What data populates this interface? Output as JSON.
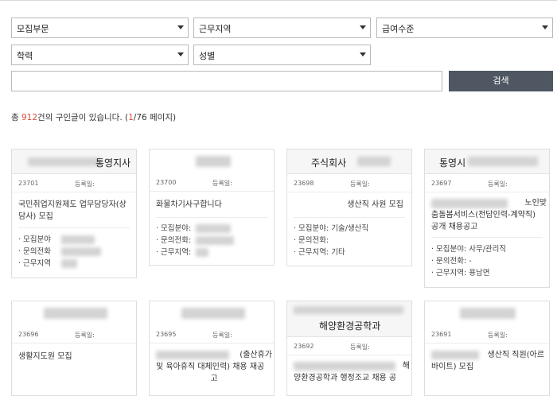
{
  "filters": {
    "job_category": "모집부문",
    "work_area": "근무지역",
    "salary": "급여수준",
    "education": "학력",
    "gender": "성별"
  },
  "search": {
    "button_label": "검색",
    "query": ""
  },
  "summary": {
    "prefix": "총 ",
    "count": "912",
    "middle": "건의 구인글이 있습니다. (",
    "page": "1",
    "suffix": "/76 페이지)"
  },
  "cards": [
    {
      "company": "통영지사",
      "number": "23701",
      "reg_label": "등록일:",
      "title_l1": "국민취업지원제도 업무담당자(상",
      "title_l2": "담사) 모집",
      "item1": "· 모집분야",
      "item2": "· 문의전화",
      "item3": "· 근무지역"
    },
    {
      "company": "",
      "number": "23700",
      "reg_label": "등록일:",
      "title_l1": "화물차기사구합니다",
      "item1": "· 모집분야:",
      "item2": "· 문의전화:",
      "item3": "· 근무지역:"
    },
    {
      "company": "주식회사",
      "number": "23698",
      "reg_label": "등록일:",
      "title_l1": "생산직 사원 모집",
      "item1": "· 모집분야: 기술/생산직",
      "item2": "· 문의전화:",
      "item3": "· 근무지역: 기타"
    },
    {
      "company": "통영시",
      "number": "23697",
      "reg_label": "등록일:",
      "title_l1": "노인맞",
      "title_l2": "춤돌봄서비스(전담인력-계약직)",
      "title_l3": "공개 채용공고",
      "item1": "· 모집분야: 사무/관리직",
      "item2": "· 문의전화: -",
      "item3": "· 근무지역: 용남면"
    },
    {
      "company": "",
      "number": "23696",
      "reg_label": "등록일:",
      "title_l1": "생활지도원 모집"
    },
    {
      "company": "",
      "number": "23695",
      "reg_label": "등록일:",
      "title_l1": "(출산휴가",
      "title_l2": "및 육아휴직 대체인력) 채용 재공",
      "title_l3": "고"
    },
    {
      "company": "해양환경공학과",
      "number": "23692",
      "reg_label": "등록일:",
      "title_l1": "해",
      "title_l2": "양환경공학과 행정조교 채용 공"
    },
    {
      "company": "",
      "number": "23691",
      "reg_label": "등록일:",
      "title_l1": "생산직 직원(아르",
      "title_l2": "바이트) 모집"
    }
  ]
}
